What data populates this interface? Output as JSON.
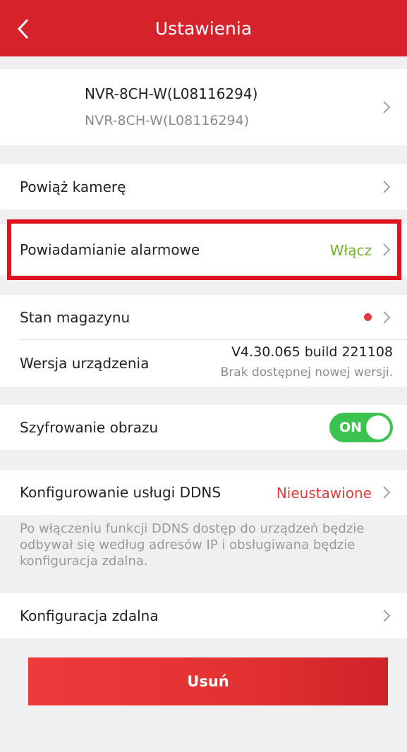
{
  "header": {
    "title": "Ustawienia"
  },
  "device": {
    "name": "NVR-8CH-W(L08116294)",
    "subtitle": "NVR-8CH-W(L08116294)"
  },
  "rows": {
    "link_camera": {
      "label": "Powiąż kamerę"
    },
    "alarm_notification": {
      "label": "Powiadamianie alarmowe",
      "value": "Włącz"
    },
    "storage_status": {
      "label": "Stan magazynu",
      "indicator_color": "#e23b3b"
    },
    "device_version": {
      "label": "Wersja urządzenia",
      "version": "V4.30.065 build 221108",
      "note": "Brak dostępnej nowej wersji."
    },
    "image_encryption": {
      "label": "Szyfrowanie obrazu",
      "toggle": "ON"
    },
    "ddns": {
      "label": "Konfigurowanie usługi DDNS",
      "value": "Nieustawione",
      "info": "Po włączeniu funkcji DDNS dostęp do urządzeń będzie odbywał się według adresów IP i obsługiwana będzie konfiguracja zdalna."
    },
    "remote_config": {
      "label": "Konfiguracja zdalna"
    }
  },
  "actions": {
    "delete_label": "Usuń"
  },
  "colors": {
    "header": "#d6222a",
    "accent_green": "#6fb22b",
    "warning_red": "#e23b3b",
    "toggle_on": "#3cc24f"
  }
}
